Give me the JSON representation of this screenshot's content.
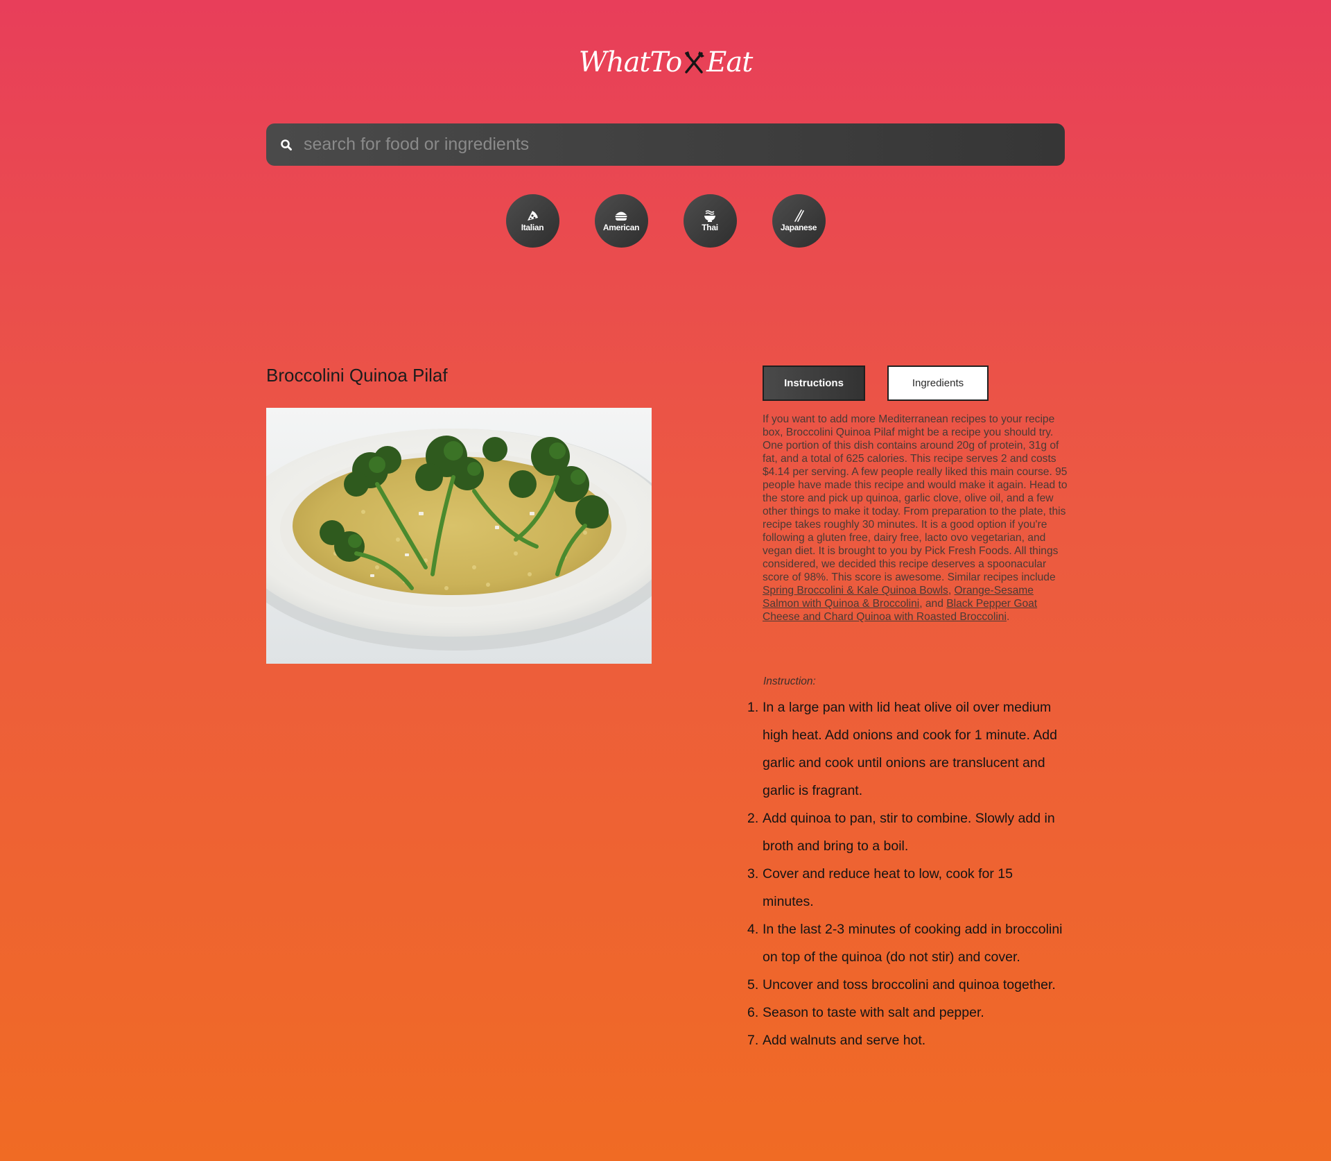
{
  "header": {
    "logo_left": "WhatTo",
    "logo_right": "Eat",
    "logo_icon": "cutlery-icon"
  },
  "search": {
    "placeholder": "search for food or ingredients",
    "value": "",
    "icon": "search-icon"
  },
  "cuisines": [
    {
      "label": "Italian",
      "icon": "pizza-icon"
    },
    {
      "label": "American",
      "icon": "burger-icon"
    },
    {
      "label": "Thai",
      "icon": "noodle-bowl-icon"
    },
    {
      "label": "Japanese",
      "icon": "chopsticks-icon"
    }
  ],
  "recipe": {
    "title": "Broccolini Quinoa Pilaf",
    "image_alt": "plate of quinoa pilaf topped with broccolini"
  },
  "tabs": {
    "instructions_label": "Instructions",
    "ingredients_label": "Ingredients",
    "active": "Instructions"
  },
  "summary": {
    "intro": "If you want to add more Mediterranean recipes to your recipe box, Broccolini Quinoa Pilaf might be a recipe you should try. One portion of this dish contains around 20g of protein, 31g of fat, and a total of 625 calories. This recipe serves 2 and costs $4.14 per serving. A few people really liked this main course. 95 people have made this recipe and would make it again. Head to the store and pick up quinoa, garlic clove, olive oil, and a few other things to make it today. From preparation to the plate, this recipe takes roughly 30 minutes. It is a good option if you're following a gluten free, dairy free, lacto ovo vegetarian, and vegan diet. It is brought to you by Pick Fresh Foods. All things considered, we decided this recipe deserves a spoonacular score of 98%. This score is awesome. Similar recipes include ",
    "link1": "Spring Broccolini & Kale Quinoa Bowls",
    "sep1": ", ",
    "link2": "Orange-Sesame Salmon with Quinoa & Broccolini",
    "sep2": ", and ",
    "link3": "Black Pepper Goat Cheese and Chard Quinoa with Roasted Broccolini",
    "end": "."
  },
  "instruction_heading": "Instruction:",
  "steps": [
    {
      "num": "1.",
      "text": "In a large pan with lid heat olive oil over medium high heat. Add onions and cook for 1 minute. Add garlic and cook until onions are translucent and garlic is fragrant."
    },
    {
      "num": "2.",
      "text": "Add quinoa to pan, stir to combine. Slowly add in broth and bring to a boil."
    },
    {
      "num": "3.",
      "text": "Cover and reduce heat to low, cook for 15 minutes."
    },
    {
      "num": "4.",
      "text": "In the last 2-3 minutes of cooking add in broccolini on top of the quinoa (do not stir) and cover."
    },
    {
      "num": "5.",
      "text": "Uncover and toss broccolini and quinoa together."
    },
    {
      "num": "6.",
      "text": "Season to taste with salt and pepper."
    },
    {
      "num": "7.",
      "text": "Add walnuts and serve hot."
    }
  ],
  "colors": {
    "gradient_top": "#e83e5a",
    "gradient_bottom": "#f06b24",
    "dark_ui": "#3a3a3a"
  }
}
